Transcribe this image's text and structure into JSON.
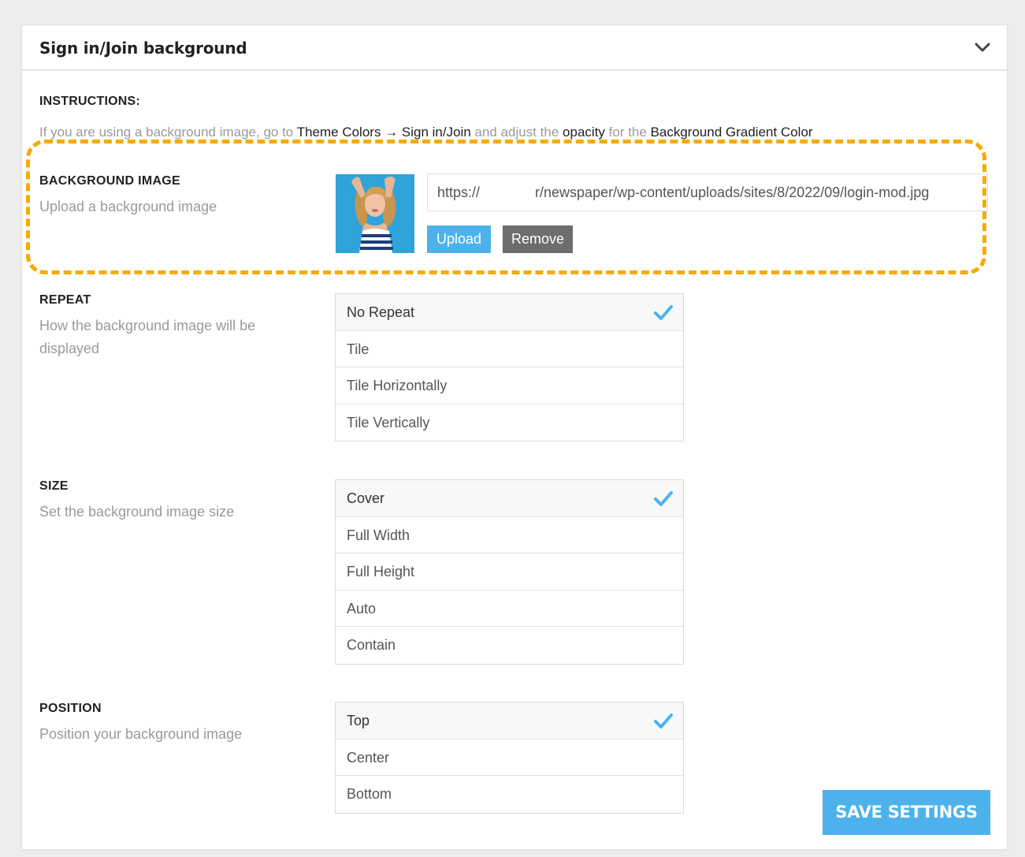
{
  "panel": {
    "title": "Sign in/Join background"
  },
  "instructions": {
    "title": "INSTRUCTIONS:",
    "text_1": "If you are using a background image, go to ",
    "link_1": "Theme Colors → Sign in/Join",
    "text_2": " and adjust the ",
    "link_2": "opacity",
    "text_3": " for the ",
    "link_3": "Background Gradient Color"
  },
  "background_image": {
    "label": "BACKGROUND IMAGE",
    "description": "Upload a background image",
    "url_start": "https://",
    "url_end": "r/newspaper/wp-content/uploads/sites/8/2022/09/login-mod.jpg",
    "upload_label": "Upload",
    "remove_label": "Remove"
  },
  "repeat": {
    "label": "REPEAT",
    "description": "How the background image will be displayed",
    "options": [
      "No Repeat",
      "Tile",
      "Tile Horizontally",
      "Tile Vertically"
    ],
    "selected": "No Repeat"
  },
  "size": {
    "label": "SIZE",
    "description": "Set the background image size",
    "options": [
      "Cover",
      "Full Width",
      "Full Height",
      "Auto",
      "Contain"
    ],
    "selected": "Cover"
  },
  "position": {
    "label": "POSITION",
    "description": "Position your background image",
    "options": [
      "Top",
      "Center",
      "Bottom"
    ],
    "selected": "Top"
  },
  "save_label": "SAVE SETTINGS",
  "colors": {
    "accent": "#4db2ec",
    "highlight": "#f6ab00",
    "remove_button": "#6d6d6d"
  },
  "icons": {
    "collapse": "chevron-down-icon",
    "selected": "checkmark-icon"
  }
}
